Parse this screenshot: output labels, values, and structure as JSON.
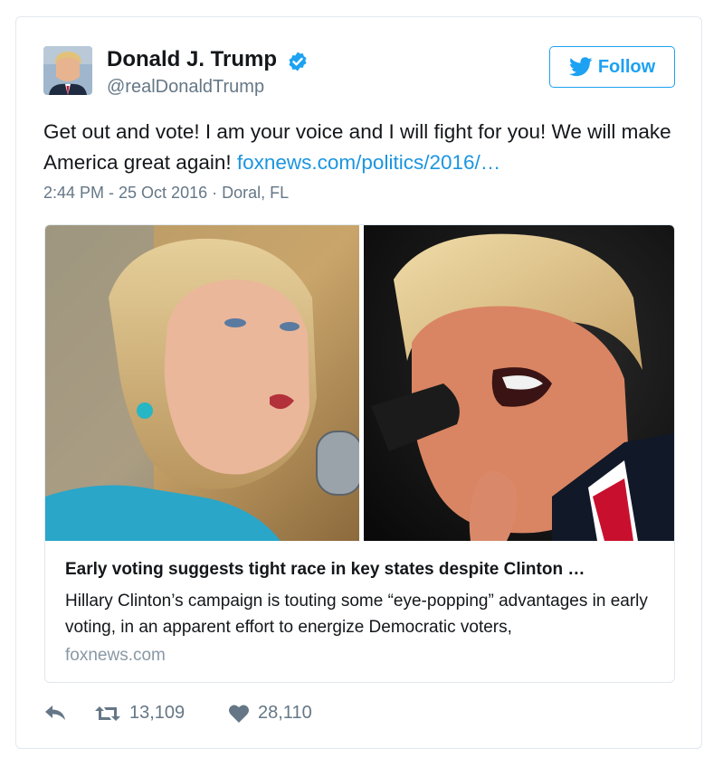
{
  "user": {
    "name": "Donald J. Trump",
    "handle": "@realDonaldTrump",
    "verified": true,
    "avatar_icon": "profile-photo"
  },
  "follow_button": {
    "label": "Follow",
    "icon": "twitter-bird-icon"
  },
  "tweet": {
    "text": "Get out and vote! I am your voice and I will fight for you! We will make America great again! ",
    "link": "foxnews.com/politics/2016/…",
    "time": "2:44 PM - 25 Oct 2016",
    "separator": " · ",
    "location": "Doral, FL"
  },
  "card": {
    "title": "Early voting suggests tight race in key states despite Clinton …",
    "description": "Hillary Clinton’s campaign is touting some “eye-popping” advantages in early voting, in an apparent effort to energize Democratic voters,",
    "domain": "foxnews.com"
  },
  "actions": {
    "reply_icon": "reply-icon",
    "retweet_icon": "retweet-icon",
    "retweets": "13,109",
    "like_icon": "heart-icon",
    "likes": "28,110"
  },
  "colors": {
    "brand_blue": "#1da1f2",
    "link_blue": "#1b95e0",
    "muted_gray": "#657786",
    "border": "#e1e8ed"
  }
}
